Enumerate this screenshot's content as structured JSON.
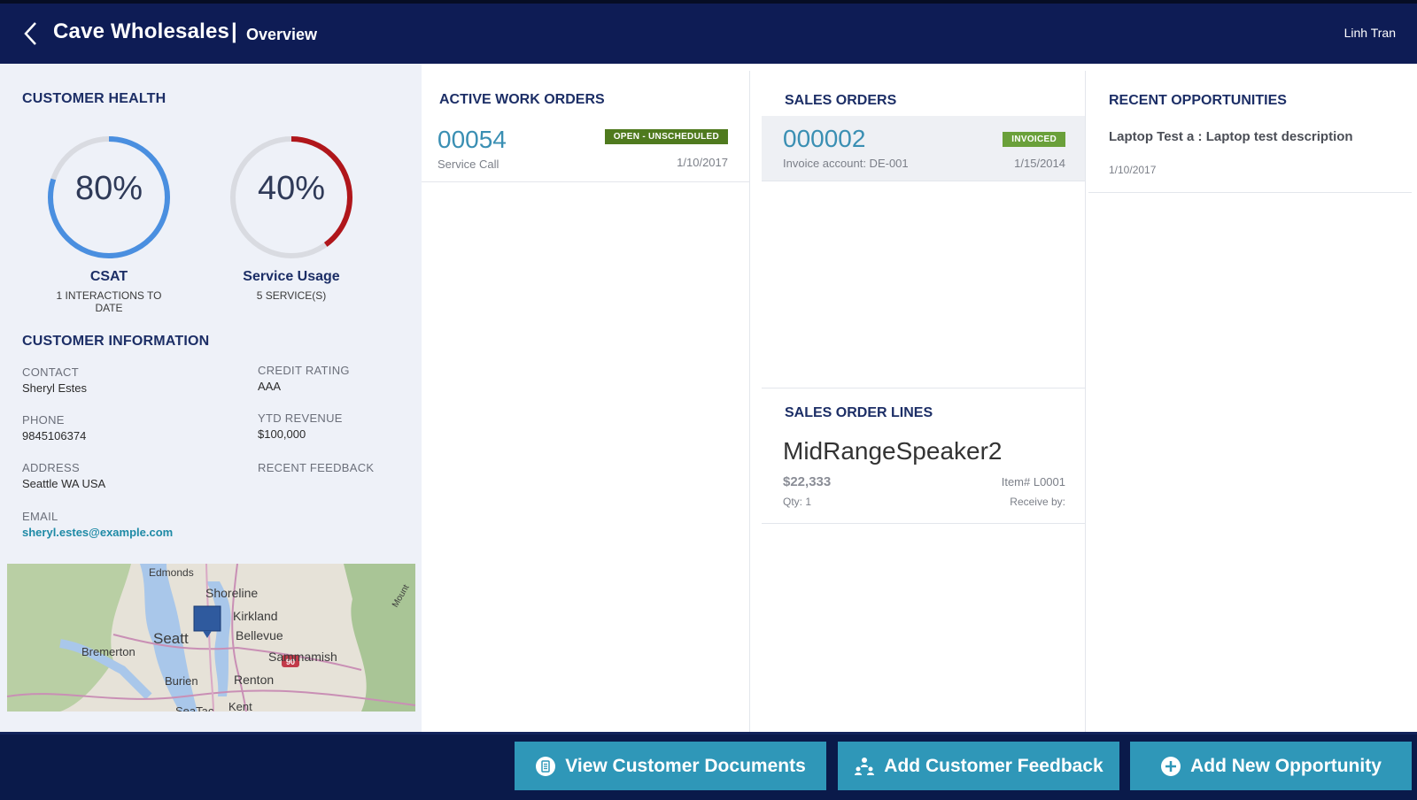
{
  "header": {
    "app_title": "Cave Wholesales",
    "separator": "|",
    "page_title": "Overview",
    "user": "Linh Tran"
  },
  "customer_health": {
    "title": "CUSTOMER HEALTH",
    "csat": {
      "value_text": "80%",
      "value": 80,
      "label": "CSAT",
      "sub": "1 INTERACTIONS TO DATE",
      "color": "#4a8fe0"
    },
    "service_usage": {
      "value_text": "40%",
      "value": 40,
      "label": "Service Usage",
      "sub": "5 SERVICE(S)",
      "color": "#b0161b"
    }
  },
  "customer_info": {
    "title": "CUSTOMER INFORMATION",
    "contact_label": "CONTACT",
    "contact": "Sheryl Estes",
    "credit_label": "CREDIT RATING",
    "credit": "AAA",
    "phone_label": "PHONE",
    "phone": "9845106374",
    "ytd_label": "YTD REVENUE",
    "ytd": "$100,000",
    "address_label": "ADDRESS",
    "address": "Seattle WA USA",
    "feedback_label": "RECENT FEEDBACK",
    "email_label": "EMAIL",
    "email": "sheryl.estes@example.com"
  },
  "map": {
    "labels": [
      "Edmonds",
      "Shoreline",
      "Kirkland",
      "Seatt",
      "Bellevue",
      "Bremerton",
      "Sammamish",
      "Burien",
      "Renton",
      "SeaTac",
      "Kent",
      "Mount"
    ],
    "highway": "90"
  },
  "work_orders": {
    "title": "ACTIVE WORK ORDERS",
    "number": "00054",
    "status": "OPEN - UNSCHEDULED",
    "status_color": "#4f7a1e",
    "type": "Service Call",
    "date": "1/10/2017"
  },
  "sales_orders": {
    "title": "SALES ORDERS",
    "number": "000002",
    "status": "INVOICED",
    "status_color": "#6aa03a",
    "account": "Invoice account: DE-001",
    "date": "1/15/2014"
  },
  "sales_order_lines": {
    "title": "SALES ORDER LINES",
    "product": "MidRangeSpeaker2",
    "price": "$22,333",
    "item": "Item# L0001",
    "qty": "Qty: 1",
    "receive": "Receive by:"
  },
  "opportunities": {
    "title": "RECENT OPPORTUNITIES",
    "name": "Laptop Test a : Laptop test description",
    "date": "1/10/2017"
  },
  "footer": {
    "view_docs": "View Customer Documents",
    "add_feedback": "Add Customer Feedback",
    "add_opportunity": "Add New Opportunity",
    "button_color": "#2f97b8"
  }
}
